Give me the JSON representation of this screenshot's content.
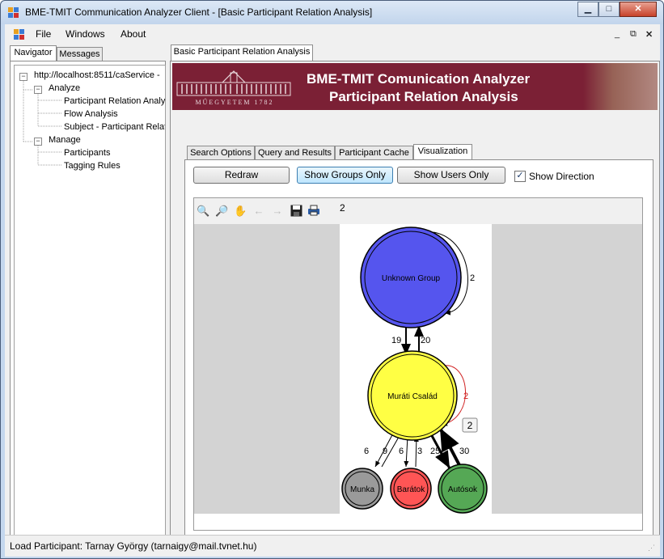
{
  "window": {
    "title": "BME-TMIT Communication Analyzer Client - [Basic Participant Relation Analysis]"
  },
  "menu": {
    "items": [
      "File",
      "Windows",
      "About"
    ]
  },
  "navigator": {
    "tabs": [
      "Navigator",
      "Messages"
    ],
    "tree": [
      {
        "label": "http://localhost:8511/caService -"
      },
      {
        "label": "Analyze"
      },
      {
        "label": "Participant Relation Analys"
      },
      {
        "label": "Flow Analysis"
      },
      {
        "label": "Subject - Participant Relat"
      },
      {
        "label": "Manage"
      },
      {
        "label": "Participants"
      },
      {
        "label": "Tagging Rules"
      }
    ]
  },
  "document": {
    "tab_label": "Basic Participant Relation Analysis",
    "banner": {
      "title_line1": "BME-TMIT Comunication Analyzer",
      "title_line2": "Participant Relation Analysis",
      "logo_caption": "MŰEGYETEM 1782"
    },
    "subtabs": [
      "Search Options",
      "Query and Results",
      "Participant  Cache",
      "Visualization"
    ],
    "active_subtab": "Visualization",
    "buttons": {
      "redraw": "Redraw",
      "show_groups": "Show Groups Only",
      "show_users": "Show Users Only"
    },
    "show_direction": {
      "label": "Show Direction",
      "checked": true
    },
    "graph_toolbar": {
      "icons": [
        "zoom-in-icon",
        "zoom-out-icon",
        "pan-hand-icon",
        "back-arrow-icon",
        "forward-arrow-icon",
        "save-icon",
        "print-icon"
      ],
      "counter": "2"
    }
  },
  "graph": {
    "nodes": [
      {
        "id": "unknown",
        "label": "Unknown Group",
        "color": "#5555ee"
      },
      {
        "id": "murati",
        "label": "Muráti Család",
        "color": "#ffff44"
      },
      {
        "id": "munka",
        "label": "Munka",
        "color": "#9a9a9a"
      },
      {
        "id": "baratok",
        "label": "Barátok",
        "color": "#ff5555"
      },
      {
        "id": "autosok",
        "label": "Autósok",
        "color": "#55a855"
      }
    ],
    "edge_labels": {
      "self_unknown": "2",
      "unknown_to_murati": "19",
      "murati_to_unknown": "20",
      "self_murati": "2",
      "munka_a": "6",
      "munka_b": "9",
      "baratok_a": "6",
      "baratok_b": "3",
      "autosok_a": "25",
      "autosok_b": "30",
      "tooltip": "2"
    }
  },
  "status": {
    "text": "Load Participant: Tarnay György (tarnaigy@mail.tvnet.hu)"
  }
}
